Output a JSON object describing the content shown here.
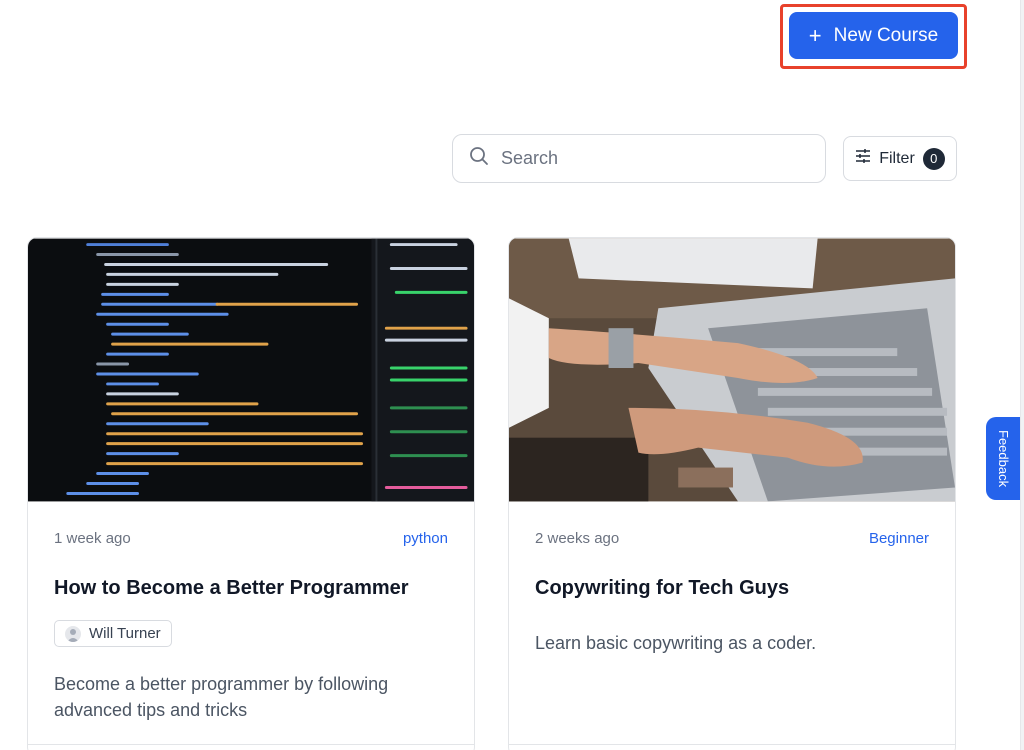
{
  "header": {
    "new_course_label": "New Course",
    "plus_icon": "+",
    "highlight_color": "#e8412b",
    "accent": "#2563eb"
  },
  "toolbar": {
    "search_placeholder": "Search",
    "filter_label": "Filter",
    "filter_count": "0"
  },
  "courses": [
    {
      "time": "1 week ago",
      "tag": "python",
      "title": "How to Become a Better Programmer",
      "author": "Will Turner",
      "description": "Become a better programmer by following advanced tips and tricks",
      "thumbnail": "code-editor-screenshot"
    },
    {
      "time": "2 weeks ago",
      "tag": "Beginner",
      "title": "Copywriting for Tech Guys",
      "description": "Learn basic copywriting as a coder.",
      "thumbnail": "hands-typing-on-laptop"
    }
  ],
  "feedback_label": "Feedback"
}
